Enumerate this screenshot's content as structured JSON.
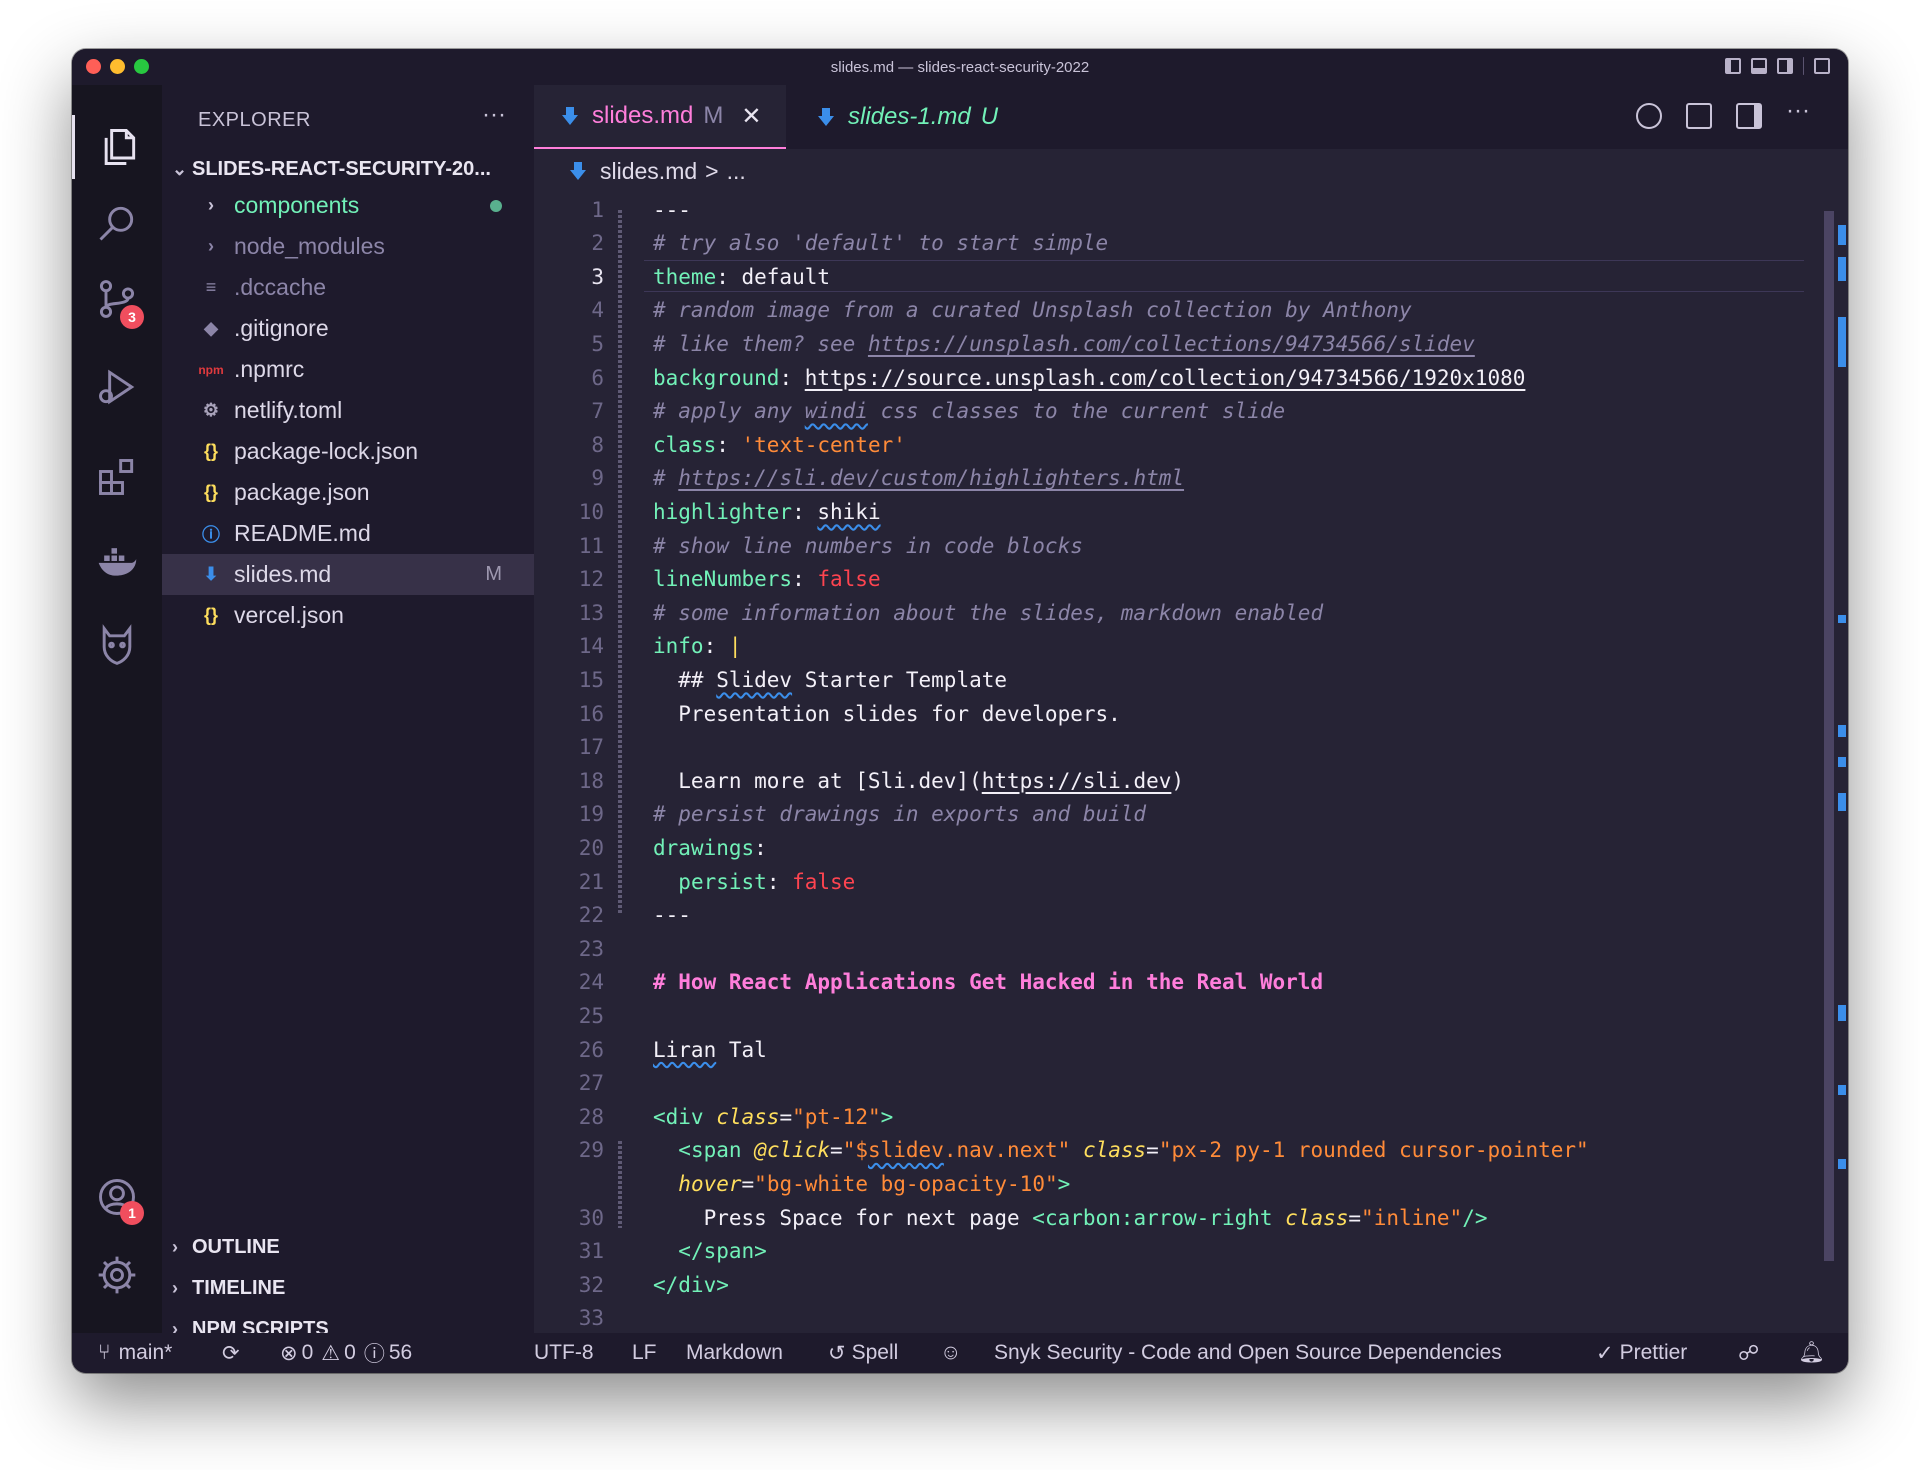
{
  "window": {
    "title": "slides.md — slides-react-security-2022"
  },
  "activity": {
    "source_control_badge": "3",
    "accounts_badge": "1"
  },
  "sidebar": {
    "header": "EXPLORER",
    "more": "···",
    "root": "SLIDES-REACT-SECURITY-20...",
    "items": [
      {
        "label": "components",
        "icon": "chevron-right-icon",
        "color": "#72f1b8"
      },
      {
        "label": "node_modules",
        "icon": "chevron-right-icon",
        "color": "#8c85a8"
      },
      {
        "label": ".dccache",
        "icon": "lines-icon",
        "color": "#8c85a8"
      },
      {
        "label": ".gitignore",
        "icon": "git-diamond-icon",
        "color": "#ddd8e8"
      },
      {
        "label": ".npmrc",
        "icon": "npm-icon",
        "color": "#ddd8e8"
      },
      {
        "label": "netlify.toml",
        "icon": "gear-icon",
        "color": "#ddd8e8"
      },
      {
        "label": "package-lock.json",
        "icon": "braces-icon",
        "color": "#ddd8e8"
      },
      {
        "label": "package.json",
        "icon": "braces-icon",
        "color": "#ddd8e8"
      },
      {
        "label": "README.md",
        "icon": "info-icon",
        "color": "#ddd8e8"
      },
      {
        "label": "slides.md",
        "icon": "markdown-icon",
        "git": "M",
        "color": "#ddd8e8"
      },
      {
        "label": "vercel.json",
        "icon": "braces-icon",
        "color": "#ddd8e8"
      }
    ],
    "sections": [
      "OUTLINE",
      "TIMELINE",
      "NPM SCRIPTS"
    ]
  },
  "tabs": [
    {
      "label": "slides.md",
      "status": "M",
      "close": "✕"
    },
    {
      "label": "slides-1.md",
      "status": "U"
    }
  ],
  "breadcrumb": {
    "file": "slides.md",
    "sep": ">",
    "rest": "..."
  },
  "code": {
    "current_line": 3,
    "lines": [
      {
        "n": "1",
        "html": "---"
      },
      {
        "n": "2",
        "html": "<span class='c'># try also 'default' to start simple</span>"
      },
      {
        "n": "3",
        "html": "<span class='k'>theme</span>: default"
      },
      {
        "n": "4",
        "html": "<span class='c'># random image from a curated Unsplash collection by Anthony</span>"
      },
      {
        "n": "5",
        "html": "<span class='c'># like them? see <span class='u'>https://unsplash.com/collections/94734566/slidev</span></span>"
      },
      {
        "n": "6",
        "html": "<span class='k'>background</span>: <span class='u'>https://source.unsplash.com/collection/94734566/1920x1080</span>"
      },
      {
        "n": "7",
        "html": "<span class='c'># apply any <span class='sq'>windi</span> css classes to the current slide</span>"
      },
      {
        "n": "8",
        "html": "<span class='k'>class</span>: <span class='s'>'text-center'</span>"
      },
      {
        "n": "9",
        "html": "<span class='c'># <span class='u'>https://sli.dev/custom/highlighters.html</span></span>"
      },
      {
        "n": "10",
        "html": "<span class='k'>highlighter</span>: <span class='sq'>shiki</span>"
      },
      {
        "n": "11",
        "html": "<span class='c'># show line numbers in code blocks</span>"
      },
      {
        "n": "12",
        "html": "<span class='k'>lineNumbers</span>: <span class='b'>false</span>"
      },
      {
        "n": "13",
        "html": "<span class='c'># some information about the slides, markdown enabled</span>"
      },
      {
        "n": "14",
        "html": "<span class='k'>info</span>: <span style='color:#fede5d'>|</span>"
      },
      {
        "n": "15",
        "html": "  ## <span class='sq'>Slidev</span> Starter Template"
      },
      {
        "n": "16",
        "html": "  Presentation slides for developers."
      },
      {
        "n": "17",
        "html": ""
      },
      {
        "n": "18",
        "html": "  Learn more at [Sli.dev](<span class='u'>https://sli.dev</span>)"
      },
      {
        "n": "19",
        "html": "<span class='c'># persist drawings in exports and build</span>"
      },
      {
        "n": "20",
        "html": "<span class='k'>drawings</span>:"
      },
      {
        "n": "21",
        "html": "  <span class='k'>persist</span>: <span class='b'>false</span>"
      },
      {
        "n": "22",
        "html": "---"
      },
      {
        "n": "23",
        "html": ""
      },
      {
        "n": "24",
        "html": "<span class='h'># How React Applications Get Hacked in the Real World</span>"
      },
      {
        "n": "25",
        "html": ""
      },
      {
        "n": "26",
        "html": "<span class='sq'>Liran</span> Tal"
      },
      {
        "n": "27",
        "html": ""
      },
      {
        "n": "28",
        "html": "<span class='tag'>&lt;div</span> <span class='attr'>class</span>=<span class='s'>\"pt-12\"</span><span class='tag'>&gt;</span>"
      },
      {
        "n": "29",
        "html": "  <span class='tag'>&lt;span</span> <span class='attr'>@click</span>=<span class='s'>\"$<span class='sq'>slidev</span>.nav.next\"</span> <span class='attr'>class</span>=<span class='s'>\"px-2 py-1 rounded cursor-pointer\"</span>"
      },
      {
        "n": "",
        "html": "  <span class='attr'>hover</span>=<span class='s'>\"bg-white bg-opacity-10\"</span><span class='tag'>&gt;</span>"
      },
      {
        "n": "30",
        "html": "    Press Space for next page <span class='tag'>&lt;carbon:arrow-right</span> <span class='attr'>class</span>=<span class='s'>\"inline\"</span><span class='tag'>/&gt;</span>"
      },
      {
        "n": "31",
        "html": "  <span class='tag'>&lt;/span&gt;</span>"
      },
      {
        "n": "32",
        "html": "<span class='tag'>&lt;/div&gt;</span>"
      },
      {
        "n": "33",
        "html": ""
      }
    ]
  },
  "statusbar": {
    "branch": "main*",
    "errors": "0",
    "warnings": "0",
    "infos": "56",
    "encoding": "UTF-8",
    "eol": "LF",
    "language": "Markdown",
    "spell": "Spell",
    "snyk": "Snyk Security - Code and Open Source Dependencies",
    "prettier": "Prettier"
  },
  "colors": {
    "accent": "#ff7edb",
    "green": "#72f1b8",
    "orange": "#ff8b39",
    "red": "#fe4450",
    "yellow": "#fede5d",
    "bg": "#262335"
  }
}
